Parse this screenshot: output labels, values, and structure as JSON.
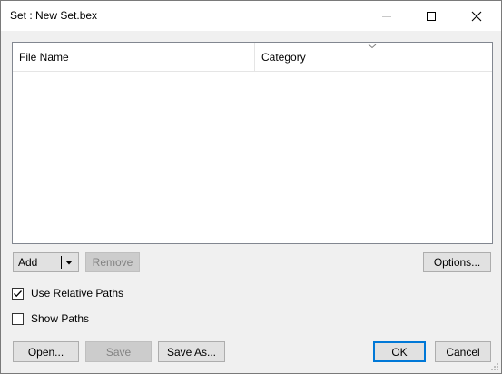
{
  "window": {
    "title": "Set : New Set.bex"
  },
  "listview": {
    "columns": [
      {
        "label": "File Name"
      },
      {
        "label": "Category"
      }
    ],
    "rows": []
  },
  "buttons": {
    "add": "Add",
    "remove": "Remove",
    "options": "Options...",
    "open": "Open...",
    "save": "Save",
    "save_as": "Save As...",
    "ok": "OK",
    "cancel": "Cancel"
  },
  "checkboxes": {
    "use_relative_paths": {
      "label": "Use Relative Paths",
      "checked": true
    },
    "show_paths": {
      "label": "Show Paths",
      "checked": false
    }
  },
  "colors": {
    "accent": "#0078d7",
    "disabled_text": "#838383"
  }
}
